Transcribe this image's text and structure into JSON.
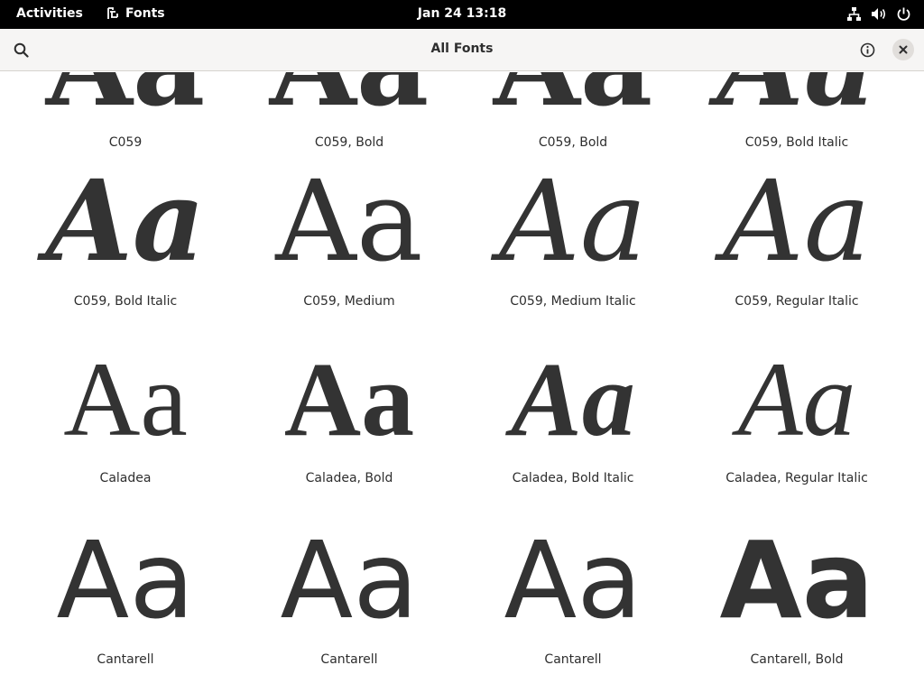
{
  "topbar": {
    "activities": "Activities",
    "app_name": "Fonts",
    "clock": "Jan 24  13:18",
    "icons": [
      "network-icon",
      "volume-icon",
      "power-icon"
    ]
  },
  "header": {
    "title": "All Fonts",
    "search_icon": "search-icon",
    "info_icon": "info-icon",
    "close_icon": "close-icon"
  },
  "fonts": [
    {
      "sample": "Aa",
      "name": "C059"
    },
    {
      "sample": "Aa",
      "name": "C059, Bold"
    },
    {
      "sample": "Aa",
      "name": "C059, Bold"
    },
    {
      "sample": "Aa",
      "name": "C059, Bold Italic"
    },
    {
      "sample": "Aa",
      "name": "C059, Bold Italic"
    },
    {
      "sample": "Aa",
      "name": "C059, Medium"
    },
    {
      "sample": "Aa",
      "name": "C059, Medium Italic"
    },
    {
      "sample": "Aa",
      "name": "C059, Regular Italic"
    },
    {
      "sample": "Aa",
      "name": "Caladea"
    },
    {
      "sample": "Aa",
      "name": "Caladea, Bold"
    },
    {
      "sample": "Aa",
      "name": "Caladea, Bold Italic"
    },
    {
      "sample": "Aa",
      "name": "Caladea, Regular Italic"
    },
    {
      "sample": "Aa",
      "name": "Cantarell"
    },
    {
      "sample": "Aa",
      "name": "Cantarell"
    },
    {
      "sample": "Aa",
      "name": "Cantarell"
    },
    {
      "sample": "Aa",
      "name": "Cantarell, Bold"
    }
  ]
}
